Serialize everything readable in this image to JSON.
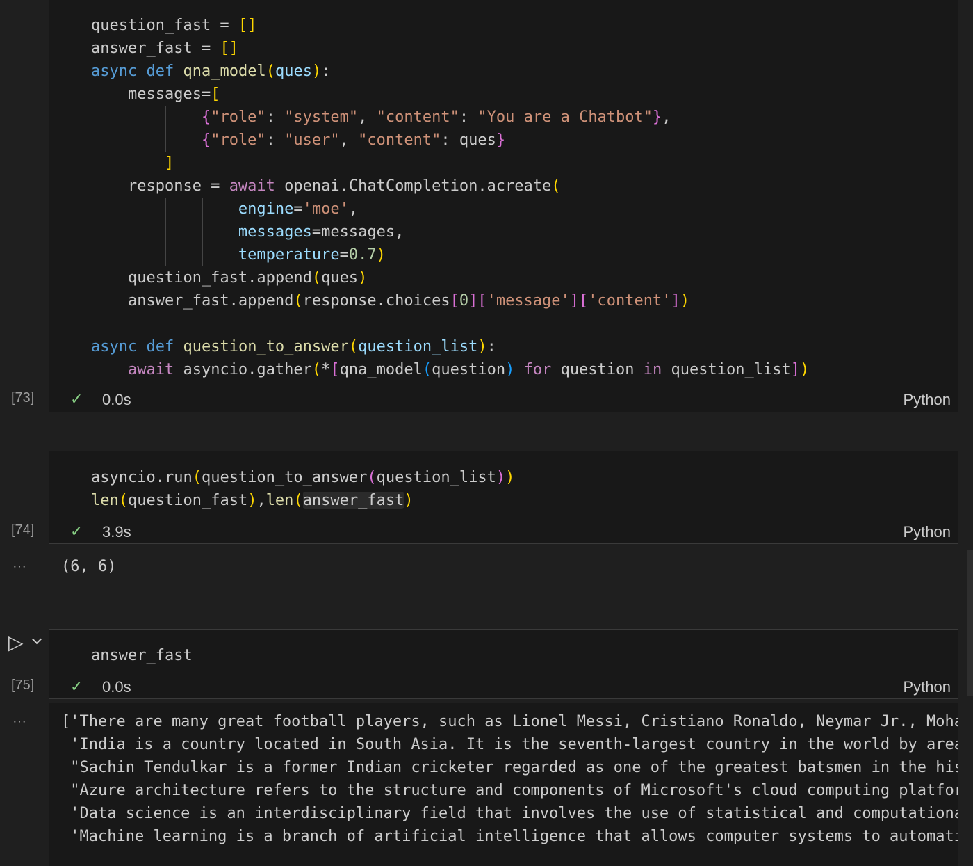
{
  "cells": [
    {
      "exec_count": "[73]",
      "status_time": "0.0s",
      "language": "Python",
      "code_lines": [
        [
          [
            "t",
            "question_fast = "
          ],
          [
            "b1",
            "[]"
          ]
        ],
        [
          [
            "t",
            "answer_fast = "
          ],
          [
            "b1",
            "[]"
          ]
        ],
        [
          [
            "kw",
            "async"
          ],
          [
            "t",
            " "
          ],
          [
            "kw",
            "def"
          ],
          [
            "t",
            " "
          ],
          [
            "fn",
            "qna_model"
          ],
          [
            "b1",
            "("
          ],
          [
            "var",
            "ques"
          ],
          [
            "b1",
            ")"
          ],
          [
            "t",
            ":"
          ]
        ],
        [
          [
            "t",
            "    messages="
          ],
          [
            "b1",
            "["
          ]
        ],
        [
          [
            "t",
            "            "
          ],
          [
            "b2",
            "{"
          ],
          [
            "str",
            "\"role\""
          ],
          [
            "t",
            ": "
          ],
          [
            "str",
            "\"system\""
          ],
          [
            "t",
            ", "
          ],
          [
            "str",
            "\"content\""
          ],
          [
            "t",
            ": "
          ],
          [
            "str",
            "\"You are a Chatbot\""
          ],
          [
            "b2",
            "}"
          ],
          [
            "t",
            ","
          ]
        ],
        [
          [
            "t",
            "            "
          ],
          [
            "b2",
            "{"
          ],
          [
            "str",
            "\"role\""
          ],
          [
            "t",
            ": "
          ],
          [
            "str",
            "\"user\""
          ],
          [
            "t",
            ", "
          ],
          [
            "str",
            "\"content\""
          ],
          [
            "t",
            ": ques"
          ],
          [
            "b2",
            "}"
          ]
        ],
        [
          [
            "t",
            "        "
          ],
          [
            "b1",
            "]"
          ]
        ],
        [
          [
            "t",
            "    response = "
          ],
          [
            "ctl",
            "await"
          ],
          [
            "t",
            " openai.ChatCompletion.acreate"
          ],
          [
            "b1",
            "("
          ]
        ],
        [
          [
            "t",
            "                "
          ],
          [
            "var",
            "engine"
          ],
          [
            "t",
            "="
          ],
          [
            "str",
            "'moe'"
          ],
          [
            "t",
            ","
          ]
        ],
        [
          [
            "t",
            "                "
          ],
          [
            "var",
            "messages"
          ],
          [
            "t",
            "=messages,"
          ]
        ],
        [
          [
            "t",
            "                "
          ],
          [
            "var",
            "temperature"
          ],
          [
            "t",
            "="
          ],
          [
            "num",
            "0.7"
          ],
          [
            "b1",
            ")"
          ]
        ],
        [
          [
            "t",
            "    question_fast.append"
          ],
          [
            "b1",
            "("
          ],
          [
            "t",
            "ques"
          ],
          [
            "b1",
            ")"
          ]
        ],
        [
          [
            "t",
            "    answer_fast.append"
          ],
          [
            "b1",
            "("
          ],
          [
            "t",
            "response.choices"
          ],
          [
            "b2",
            "["
          ],
          [
            "num",
            "0"
          ],
          [
            "b2",
            "]["
          ],
          [
            "str",
            "'message'"
          ],
          [
            "b2",
            "]["
          ],
          [
            "str",
            "'content'"
          ],
          [
            "b2",
            "]"
          ],
          [
            "b1",
            ")"
          ]
        ],
        [
          [
            "t",
            ""
          ]
        ],
        [
          [
            "kw",
            "async"
          ],
          [
            "t",
            " "
          ],
          [
            "kw",
            "def"
          ],
          [
            "t",
            " "
          ],
          [
            "fn",
            "question_to_answer"
          ],
          [
            "b1",
            "("
          ],
          [
            "var",
            "question_list"
          ],
          [
            "b1",
            ")"
          ],
          [
            "t",
            ":"
          ]
        ],
        [
          [
            "t",
            "    "
          ],
          [
            "ctl",
            "await"
          ],
          [
            "t",
            " asyncio.gather"
          ],
          [
            "b1",
            "("
          ],
          [
            "t",
            "*"
          ],
          [
            "b2",
            "["
          ],
          [
            "t",
            "qna_model"
          ],
          [
            "b3",
            "("
          ],
          [
            "t",
            "question"
          ],
          [
            "b3",
            ")"
          ],
          [
            "t",
            " "
          ],
          [
            "ctl",
            "for"
          ],
          [
            "t",
            " question "
          ],
          [
            "ctl",
            "in"
          ],
          [
            "t",
            " question_list"
          ],
          [
            "b2",
            "]"
          ],
          [
            "b1",
            ")"
          ]
        ]
      ]
    },
    {
      "exec_count": "[74]",
      "status_time": "3.9s",
      "language": "Python",
      "code_lines": [
        [
          [
            "t",
            "asyncio.run"
          ],
          [
            "b1",
            "("
          ],
          [
            "t",
            "question_to_answer"
          ],
          [
            "b2",
            "("
          ],
          [
            "t",
            "question_list"
          ],
          [
            "b2",
            ")"
          ],
          [
            "b1",
            ")"
          ]
        ],
        [
          [
            "fn",
            "len"
          ],
          [
            "b1",
            "("
          ],
          [
            "t",
            "question_fast"
          ],
          [
            "b1",
            ")"
          ],
          [
            "t",
            ","
          ],
          [
            "fn",
            "len"
          ],
          [
            "b1",
            "("
          ],
          [
            "hl",
            "answer_fast"
          ],
          [
            "b1",
            ")"
          ]
        ]
      ],
      "output": [
        "(6, 6)"
      ]
    },
    {
      "exec_count": "[75]",
      "status_time": "0.0s",
      "language": "Python",
      "code_lines": [
        [
          [
            "t",
            "answer_fast"
          ]
        ]
      ],
      "output": [
        "['There are many great football players, such as Lionel Messi, Cristiano Ronaldo, Neymar Jr., Moham",
        " 'India is a country located in South Asia. It is the seventh-largest country in the world by area",
        " \"Sachin Tendulkar is a former Indian cricketer regarded as one of the greatest batsmen in the hist",
        " \"Azure architecture refers to the structure and components of Microsoft's cloud computing platfor",
        " 'Data science is an interdisciplinary field that involves the use of statistical and computationa",
        " 'Machine learning is a branch of artificial intelligence that allows computer systems to automati"
      ]
    }
  ],
  "icons": {
    "check": "✓",
    "run": "▷",
    "chevron": "⌵",
    "more": "···"
  }
}
